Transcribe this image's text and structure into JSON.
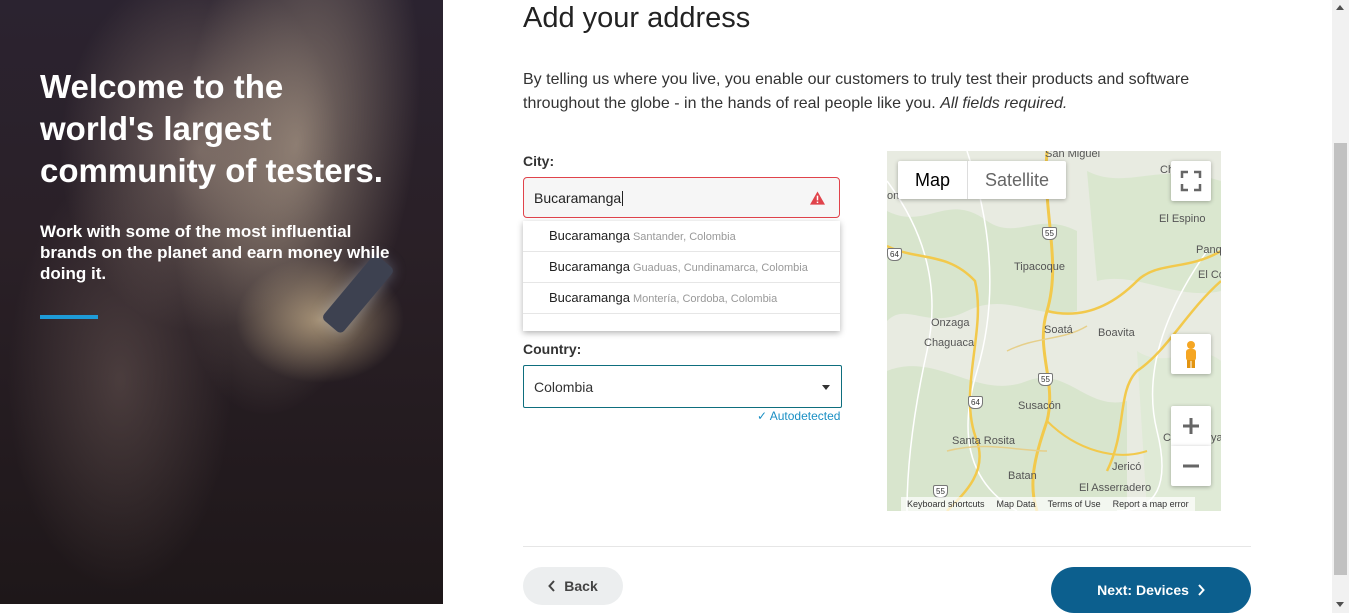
{
  "hero": {
    "title": "Welcome to the world's largest community of testers.",
    "subtitle": "Work with some of the most influential brands on the planet and earn money while doing it."
  },
  "form": {
    "title": "Add your address",
    "intro": "By telling us where you live, you enable our customers to truly test their products and software throughout the globe - in the hands of real people like you.",
    "intro_emphasis": "All fields required.",
    "city_label": "City:",
    "city_value": "Bucaramanga",
    "suggestions": [
      {
        "main": "Bucaramanga",
        "secondary": "Santander, Colombia"
      },
      {
        "main": "Bucaramanga",
        "secondary": "Guaduas, Cundinamarca, Colombia"
      },
      {
        "main": "Bucaramanga",
        "secondary": "Montería, Cordoba, Colombia"
      }
    ],
    "country_label": "Country:",
    "country_value": "Colombia",
    "autodetected": "Autodetected"
  },
  "map": {
    "type_map": "Map",
    "type_satellite": "Satellite",
    "places": [
      "San Miguel",
      "El Espino",
      "Tipacoque",
      "Panqu",
      "El Co",
      "Onzaga",
      "Soatá",
      "Boavita",
      "Chaguaca",
      "Susacón",
      "Santa Rosita",
      "Jericó",
      "Batan",
      "El Asserradero",
      "Ch",
      "Co",
      "ya",
      "on"
    ],
    "shields": [
      "55",
      "64",
      "55",
      "64",
      "55"
    ],
    "footer": [
      "Keyboard shortcuts",
      "Map Data",
      "Terms of Use",
      "Report a map error"
    ]
  },
  "nav": {
    "back_label": "Back",
    "next_label": "Next: Devices"
  },
  "colors": {
    "accent": "#1e9bd7",
    "primary_button": "#0c5f8e",
    "error": "#e0434b",
    "focus_border": "#0e6e7e",
    "link": "#1a8fc4"
  }
}
